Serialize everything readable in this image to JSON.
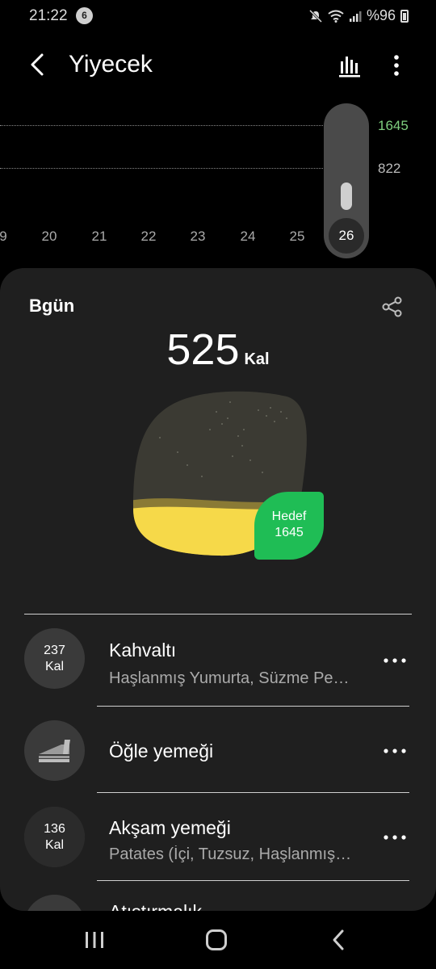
{
  "status_bar": {
    "time": "21:22",
    "notification_count": "6",
    "battery": "%96"
  },
  "app_bar": {
    "title": "Yiyecek",
    "back_icon": "chevron-left-icon",
    "chart_icon": "bar-chart-icon",
    "more_icon": "more-vertical-icon"
  },
  "chart": {
    "y_labels": [
      "1645",
      "822"
    ],
    "x_labels": [
      "9",
      "20",
      "21",
      "22",
      "23",
      "24",
      "25"
    ],
    "selected_day": "26",
    "goal_line_color": "#7fcf7f"
  },
  "summary": {
    "label": "Bgün",
    "calories": "525",
    "unit": "Kal",
    "goal_label": "Hedef",
    "goal_value": "1645",
    "share_icon": "share-icon",
    "fill_fraction": 0.32,
    "fill_color": "#f6d949",
    "goal_color": "#1fbd55"
  },
  "meals": [
    {
      "name": "Kahvaltı",
      "kcal": "237",
      "unit": "Kal",
      "desc": "Haşlanmış Yumurta, Süzme Pe…"
    },
    {
      "name": "Öğle yemeği",
      "icon": "sandwich-icon"
    },
    {
      "name": "Akşam yemeği",
      "kcal": "136",
      "unit": "Kal",
      "desc": "Patates (İçi, Tuzsuz, Haşlanmış…"
    },
    {
      "name": "Atıştırmalık"
    }
  ],
  "nav": {
    "recents_icon": "recents-icon",
    "home_icon": "home-icon",
    "back_icon": "back-icon"
  }
}
